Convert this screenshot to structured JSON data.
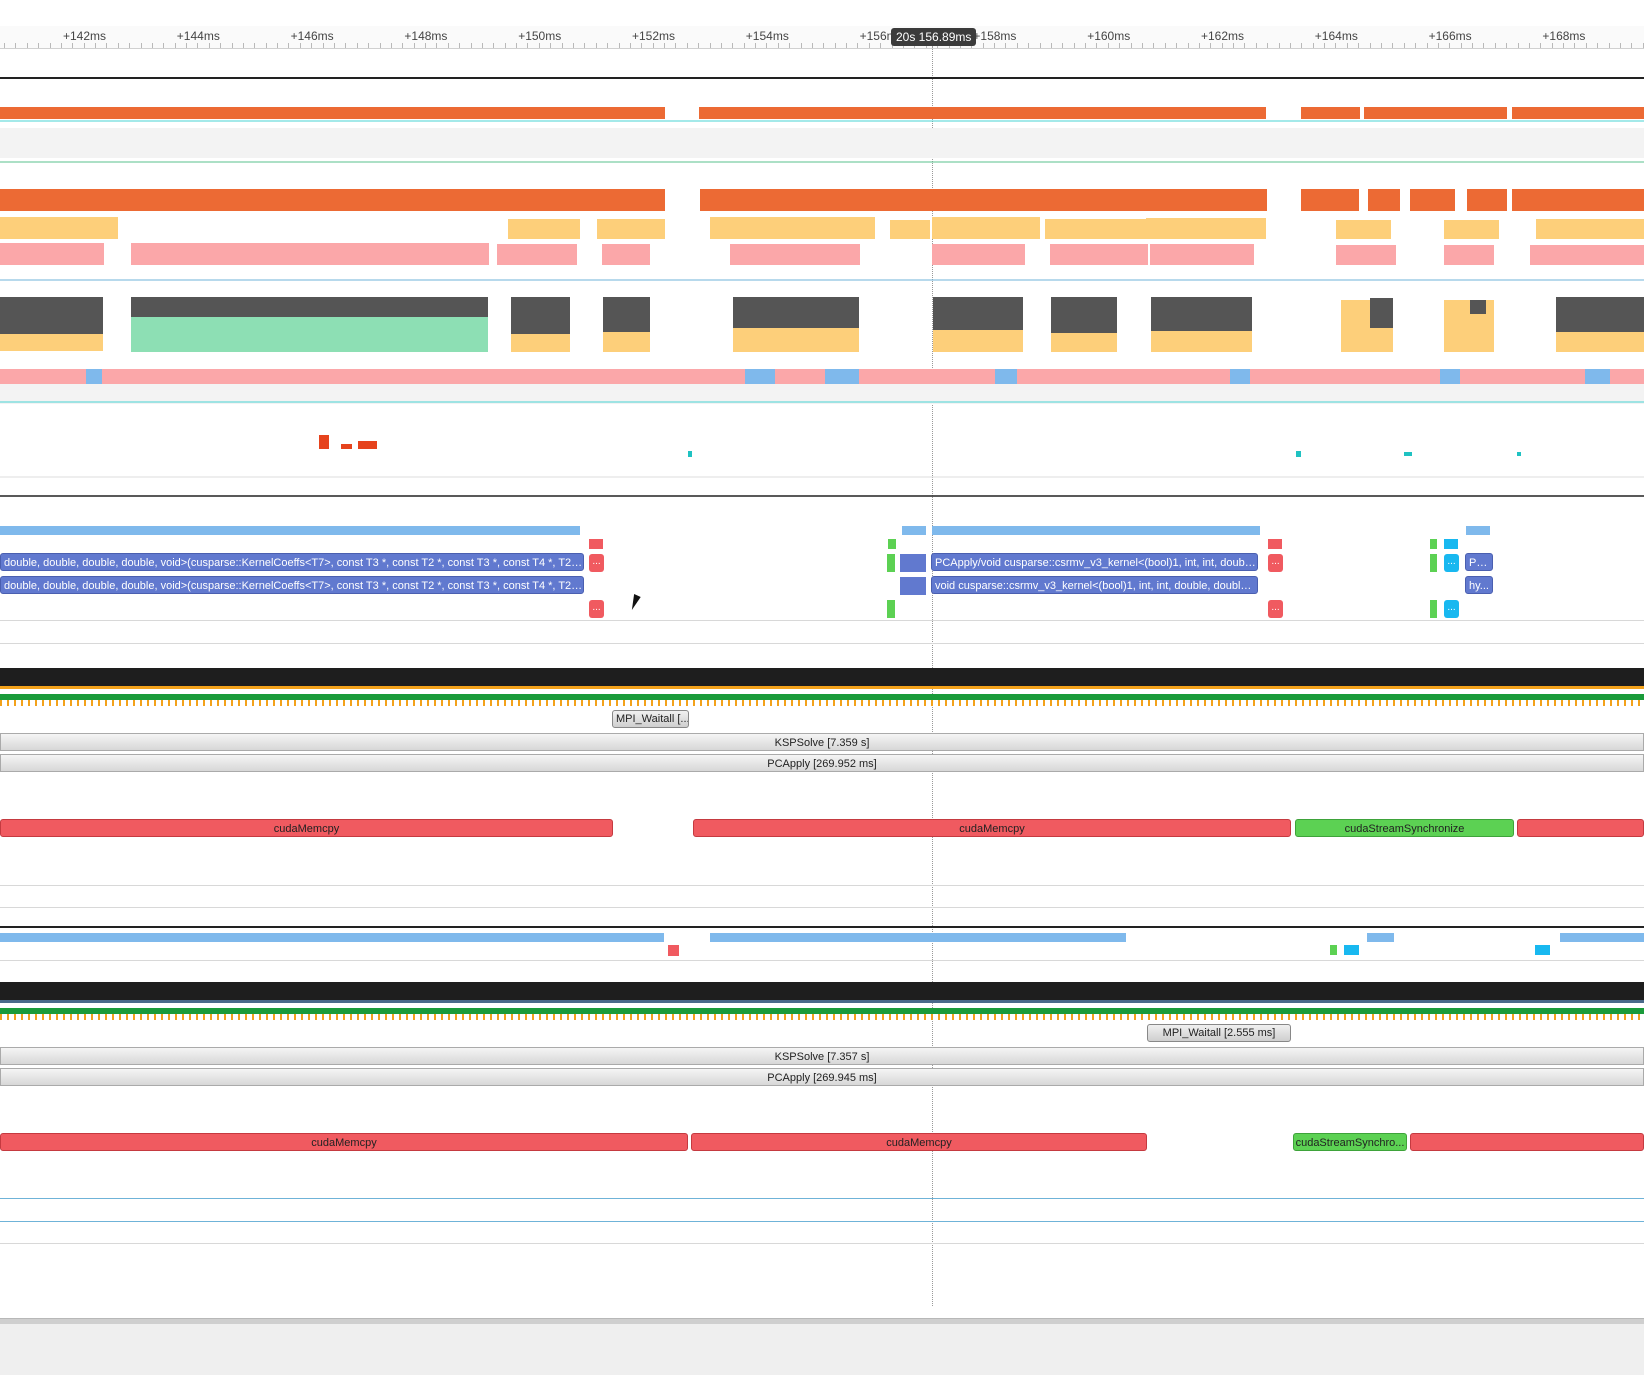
{
  "ruler": {
    "ticks": [
      "+142ms",
      "+144ms",
      "+146ms",
      "+148ms",
      "+150ms",
      "+152ms",
      "+154ms",
      "+156ms",
      "+158ms",
      "+160ms",
      "+162ms",
      "+164ms",
      "+166ms",
      "+168ms"
    ],
    "cursor_label": "20s 156.89ms"
  },
  "gpu_kernels": {
    "row1": "double, double, double, double, void>(cusparse::KernelCoeffs<T7>, const T3 *, const T2 *, const T3 *, const T4 *, T2, i...",
    "row2": "double, double, double, double, void>(cusparse::KernelCoeffs<T7>, const T3 *, const T2 *, const T3 *, const T4 *, T2, int, int, co...",
    "pcapply_kernel": "PCApply/void cusparse::csrmv_v3_kernel<(bool)1, int, int, double...",
    "csrmv_kernel": "void cusparse::csrmv_v3_kernel<(bool)1, int, int, double, double, ...",
    "short_pc": "PC...",
    "short_hy": "hy...",
    "ellipsis": "..."
  },
  "process1": {
    "mpi_waitall": "MPI_Waitall [...",
    "kspsolve": "KSPSolve [7.359 s]",
    "pcapply": "PCApply [269.952 ms]",
    "memcpy1": "cudaMemcpy",
    "memcpy2": "cudaMemcpy",
    "sync": "cudaStreamSynchronize"
  },
  "process2": {
    "mpi_waitall": "MPI_Waitall [2.555 ms]",
    "kspsolve": "KSPSolve [7.357 s]",
    "pcapply": "PCApply [269.945 ms]",
    "memcpy1": "cudaMemcpy",
    "memcpy2": "cudaMemcpy",
    "sync": "cudaStreamSynchro..."
  },
  "colors": {
    "orange": "#ec6a34",
    "yellow": "#fdcf7a",
    "pink": "#fba7a9",
    "darkgrey": "#555555",
    "mint": "#8ddfb4",
    "lightblue": "#7fb9ec",
    "kernel_blue": "#6179cf",
    "memcpy_red": "#f05a60",
    "sync_green": "#5cd153",
    "cyan": "#18b8f0"
  }
}
